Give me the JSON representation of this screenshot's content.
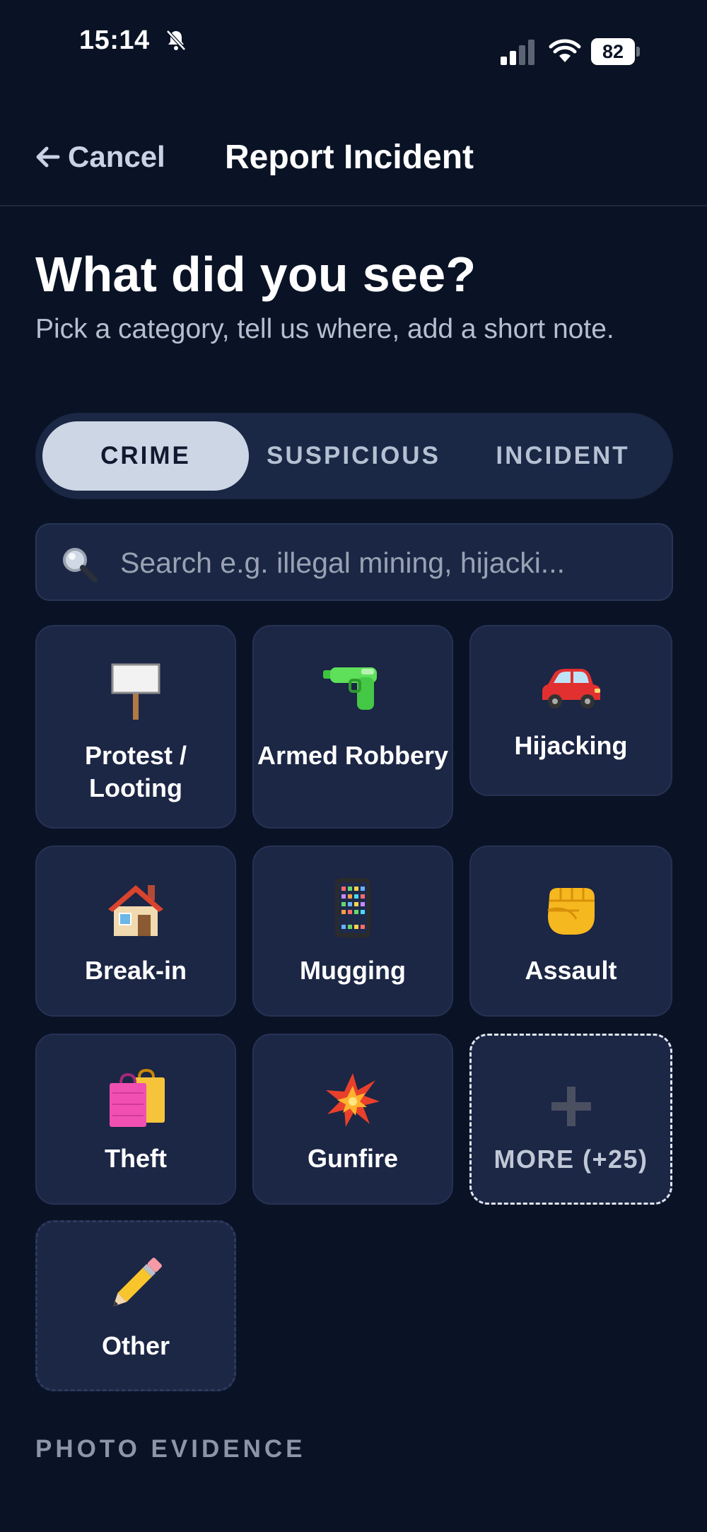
{
  "status_bar": {
    "time": "15:14",
    "battery": "82"
  },
  "header": {
    "cancel_label": "Cancel",
    "title": "Report Incident"
  },
  "intro": {
    "title": "What did you see?",
    "subtitle": "Pick a category, tell us where, add a short note."
  },
  "tabs": [
    {
      "label": "CRIME",
      "active": true
    },
    {
      "label": "SUSPICIOUS",
      "active": false
    },
    {
      "label": "INCIDENT",
      "active": false
    }
  ],
  "search": {
    "placeholder": "Search e.g. illegal mining, hijacki..."
  },
  "categories": [
    {
      "label": "Protest / Looting",
      "icon": "protest-sign-icon"
    },
    {
      "label": "Armed Robbery",
      "icon": "water-pistol-icon"
    },
    {
      "label": "Hijacking",
      "icon": "car-icon"
    },
    {
      "label": "Break-in",
      "icon": "house-icon"
    },
    {
      "label": "Mugging",
      "icon": "phone-icon"
    },
    {
      "label": "Assault",
      "icon": "fist-icon"
    },
    {
      "label": "Theft",
      "icon": "shopping-bags-icon"
    },
    {
      "label": "Gunfire",
      "icon": "explosion-icon"
    },
    {
      "label": "MORE (+25)",
      "icon": "plus-icon"
    },
    {
      "label": "Other",
      "icon": "pencil-icon"
    }
  ],
  "photo_section": {
    "label": "PHOTO EVIDENCE"
  },
  "colors": {
    "background": "#0a1325",
    "tile": "#1c2645",
    "active_tab": "#cdd6e4",
    "muted_text": "#b6bfcd"
  }
}
